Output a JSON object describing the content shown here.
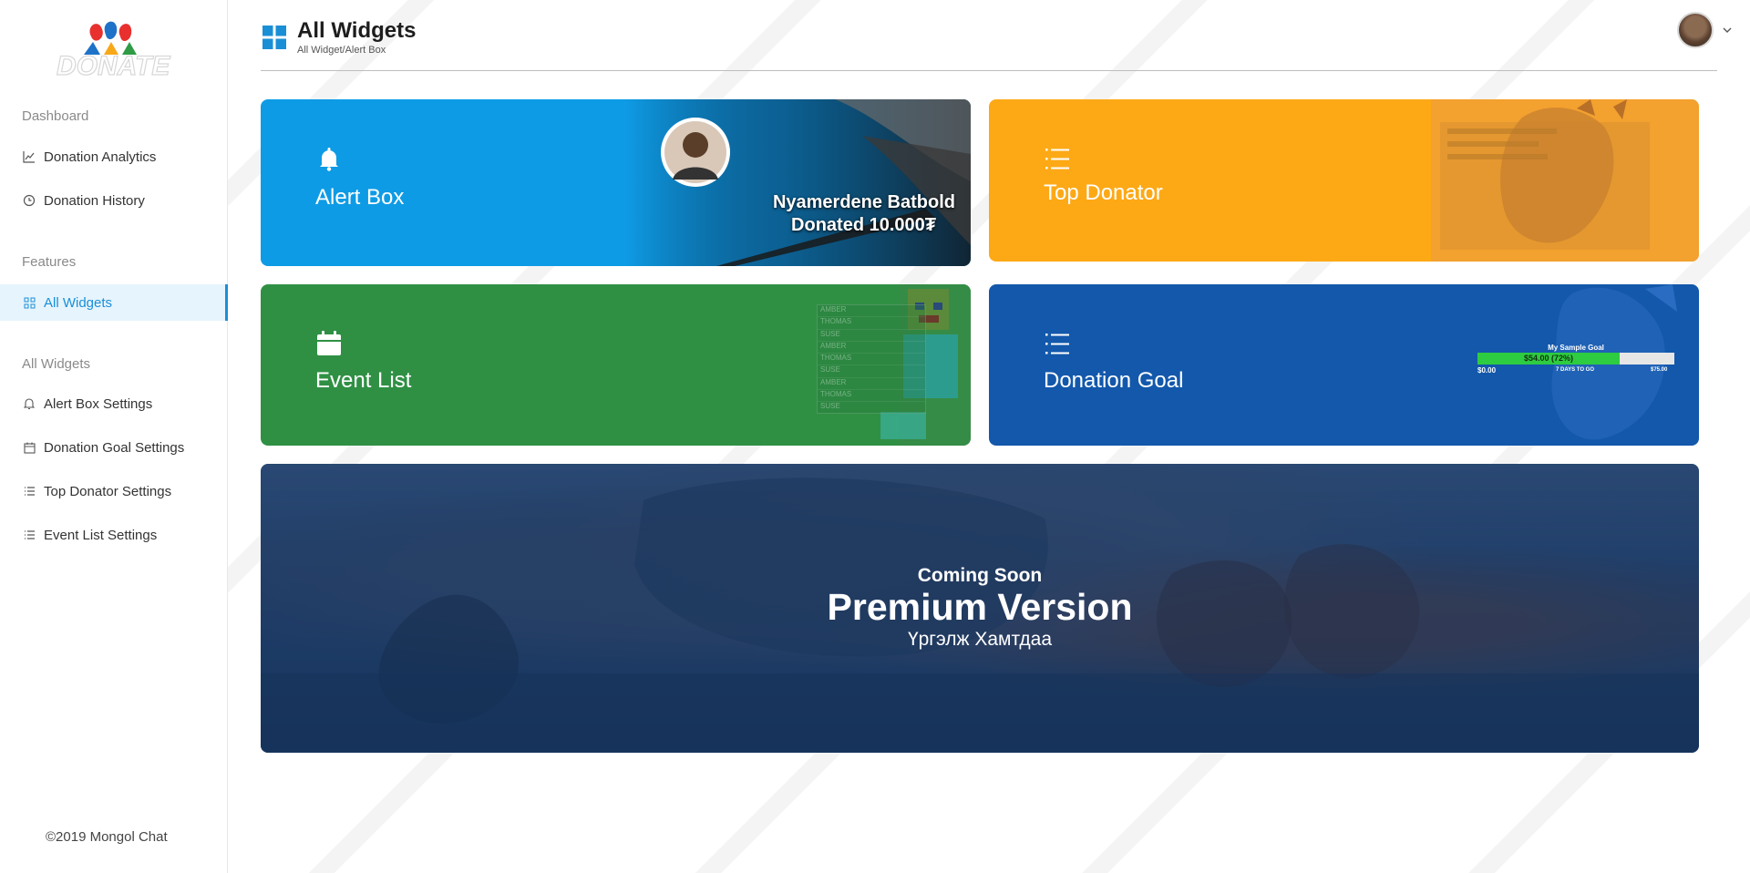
{
  "sidebar": {
    "logo_text": "DONATE",
    "section_dashboard": "Dashboard",
    "donation_analytics": "Donation Analytics",
    "donation_history": "Donation History",
    "section_features": "Features",
    "all_widgets": "All Widgets",
    "section_all_widgets": "All Widgets",
    "alert_box_settings": "Alert Box Settings",
    "donation_goal_settings": "Donation Goal Settings",
    "top_donator_settings": "Top Donator Settings",
    "event_list_settings": "Event List Settings",
    "copyright": "©2019 Mongol Chat"
  },
  "header": {
    "title": "All Widgets",
    "breadcrumb": "All Widget/Alert Box"
  },
  "cards": {
    "alert_box": {
      "title": "Alert Box",
      "donor_name": "Nyamerdene Batbold",
      "donated_text": "Donated 10.000₮"
    },
    "top_donator": {
      "title": "Top Donator"
    },
    "event_list": {
      "title": "Event List",
      "preview_names": [
        "AMBER",
        "THOMAS",
        "SUSE",
        "AMBER",
        "THOMAS",
        "SUSE",
        "AMBER",
        "THOMAS",
        "SUSE"
      ]
    },
    "donation_goal": {
      "title": "Donation Goal",
      "goal_label": "My Sample Goal",
      "goal_amount": "$54.00 (72%)",
      "goal_progress": 0.72,
      "goal_start": "$0.00",
      "goal_days": "7 DAYS TO GO",
      "goal_end": "$75.00"
    },
    "premium": {
      "coming_soon": "Coming Soon",
      "title": "Premium Version",
      "subtitle": "Үргэлж Хамтдаа"
    }
  },
  "colors": {
    "accent": "#1a8fd6",
    "alert_box": "#0e9be5",
    "top_donator": "#fda916",
    "event_list": "#2f9044",
    "donation_goal": "#1358ab"
  }
}
